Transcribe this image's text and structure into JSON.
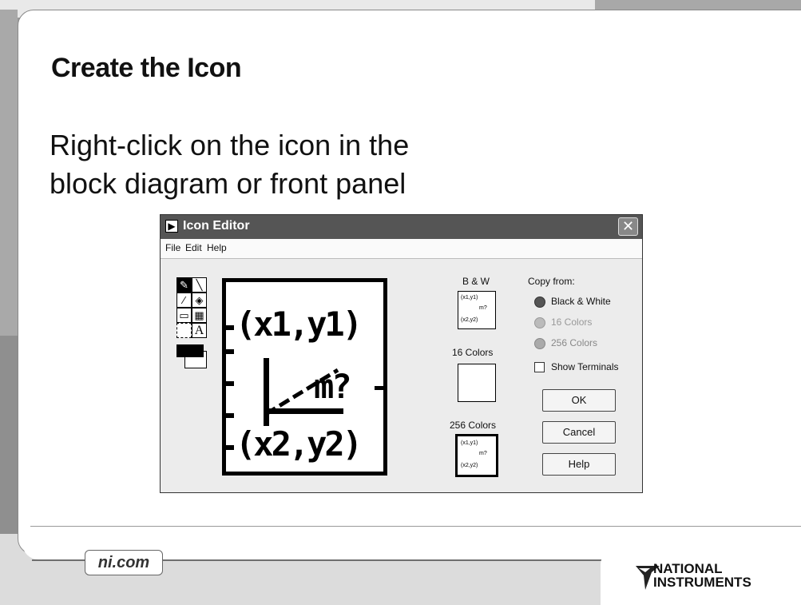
{
  "slide": {
    "title": "Create the Icon",
    "body": "Right-click on the icon in the\nblock diagram or front panel",
    "footer_link": "ni.com",
    "logo_text_line1": "NATIONAL",
    "logo_text_line2": "INSTRUMENTS"
  },
  "dialog": {
    "title": "Icon Editor",
    "close_label": "✕",
    "menu": [
      "File",
      "Edit",
      "Help"
    ],
    "tools": [
      "pencil-icon",
      "line-icon",
      "dropper-icon",
      "bucket-icon",
      "rectangle-icon",
      "filled-rectangle-icon",
      "select-icon",
      "text-icon"
    ],
    "canvas_lines": [
      "(x1,y1)",
      "m?",
      "(x2,y2)"
    ],
    "preview_lines": [
      "(x1,y1)",
      "m?",
      "(x2,y2)"
    ],
    "previews": {
      "bw_label": "B & W",
      "colors16_label": "16 Colors",
      "colors256_label": "256 Colors"
    },
    "copy_from": {
      "label": "Copy from:",
      "options": [
        "Black & White",
        "16 Colors",
        "256 Colors"
      ],
      "selected": "Black & White"
    },
    "show_terminals_label": "Show Terminals",
    "show_terminals_checked": false,
    "buttons": {
      "ok": "OK",
      "cancel": "Cancel",
      "help": "Help"
    },
    "colors": {
      "titlebar": "#555555",
      "face": "#ececec",
      "foreground": "#000000",
      "background": "#ffffff"
    }
  }
}
